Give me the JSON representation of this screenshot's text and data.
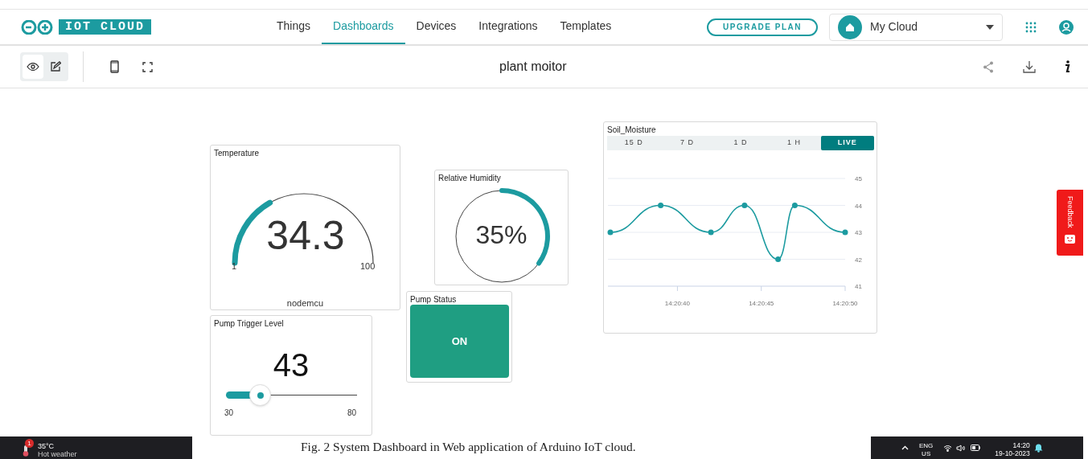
{
  "header": {
    "logo_text": "IOT CLOUD",
    "nav": [
      {
        "label": "Things",
        "selected": false
      },
      {
        "label": "Dashboards",
        "selected": true
      },
      {
        "label": "Devices",
        "selected": false
      },
      {
        "label": "Integrations",
        "selected": false
      },
      {
        "label": "Templates",
        "selected": false
      }
    ],
    "upgrade_button": "UPGRADE PLAN",
    "space_selector": {
      "value": "My Cloud"
    }
  },
  "toolbar": {
    "modes": [
      {
        "kind": "view",
        "selected": true
      },
      {
        "kind": "edit",
        "selected": false
      }
    ],
    "dashboard_title": "plant moitor"
  },
  "widgets": [
    {
      "kind": "gauge",
      "title": "Temperature",
      "value": "34.3",
      "min": "1",
      "max": "100",
      "footer": "nodemcu"
    },
    {
      "kind": "percentage",
      "title": "Relative Humidity",
      "value": "35%"
    },
    {
      "kind": "status",
      "title": "Pump Status",
      "label": "ON",
      "on": true
    },
    {
      "kind": "slider",
      "title": "Pump Trigger Level",
      "value": "43",
      "min": "30",
      "max": "80",
      "level": 0.26
    },
    {
      "kind": "chart",
      "title": "Soil_Moisture",
      "ranges": [
        {
          "label": "15 D",
          "selected": false
        },
        {
          "label": "7 D",
          "selected": false
        },
        {
          "label": "1 D",
          "selected": false
        },
        {
          "label": "1 H",
          "selected": false
        },
        {
          "label": "LIVE",
          "selected": true
        }
      ],
      "chart_data": {
        "type": "line",
        "categories": [
          null,
          null,
          null,
          null,
          "14:20:40",
          null,
          null,
          null,
          null,
          "14:20:45",
          null,
          null,
          null,
          null,
          "14:20:50"
        ],
        "grid": true,
        "series": [
          {
            "marker": true,
            "color": "#1c9ba0",
            "values": [
              43,
              null,
              null,
              44,
              null,
              null,
              43,
              null,
              44,
              null,
              42,
              44,
              null,
              null,
              43
            ]
          }
        ],
        "ylim": [
          41,
          45
        ],
        "yticks": [
          41,
          42,
          43,
          44,
          45
        ]
      }
    }
  ],
  "feedback_tab": {
    "label": "Feedback"
  },
  "caption": "Fig. 2 System Dashboard in Web application of Arduino IoT cloud.",
  "taskbar": {
    "weather": {
      "badge": "1",
      "temperature": "35°C",
      "condition": "Hot weather"
    },
    "language": "ENG",
    "region": "US",
    "time": "14:20",
    "date": "19-10-2023"
  }
}
